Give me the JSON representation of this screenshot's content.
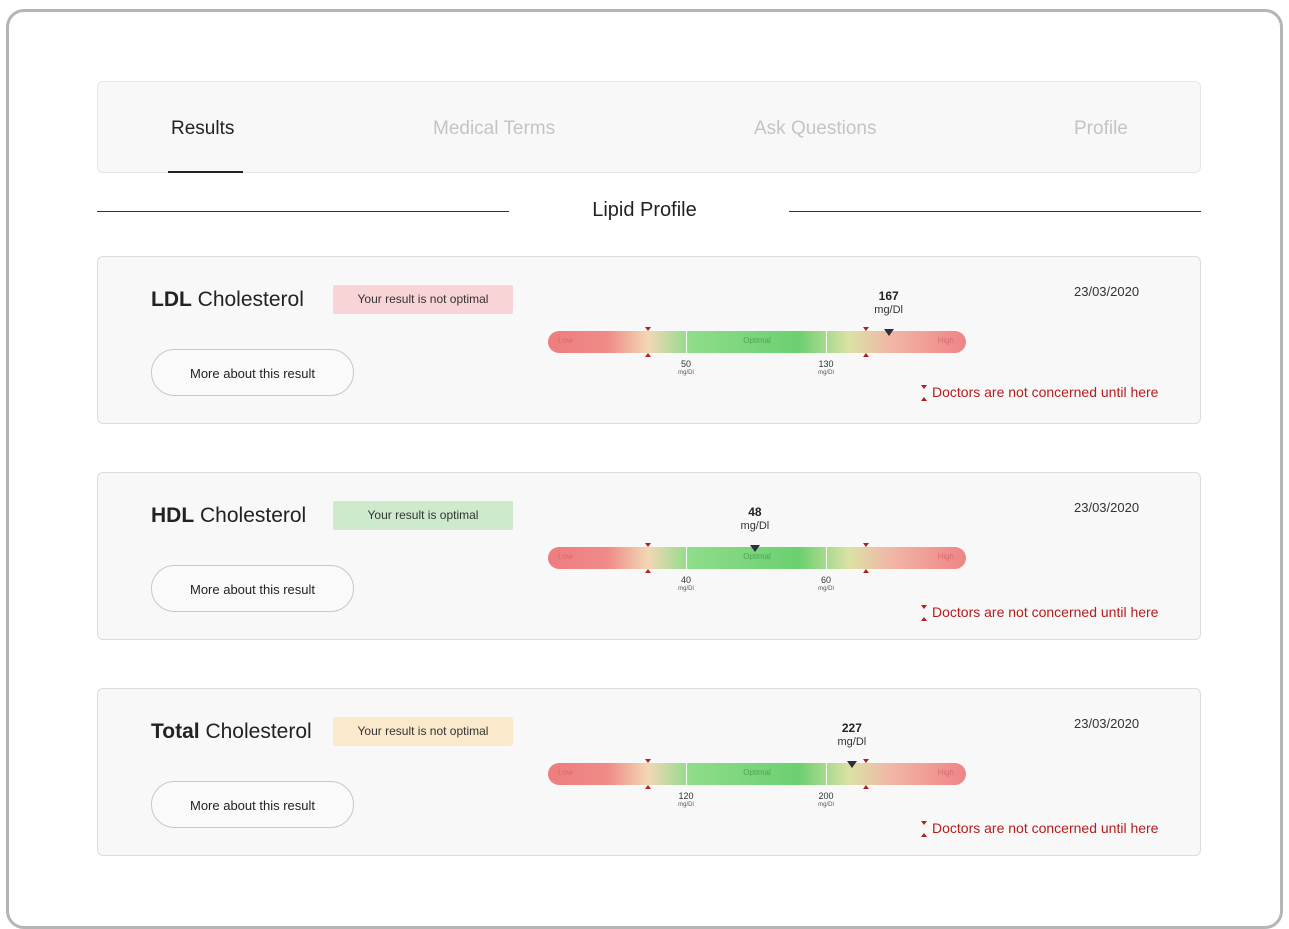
{
  "nav": {
    "tabs": [
      {
        "label": "Results"
      },
      {
        "label": "Medical Terms"
      },
      {
        "label": "Ask Questions"
      },
      {
        "label": "Profile"
      }
    ]
  },
  "section": {
    "title": "Lipid Profile"
  },
  "colors": {
    "badge_not_optimal_ldl": "#f9d4d6",
    "badge_optimal": "#cdeacd",
    "badge_not_optimal_total": "#fbe9cc",
    "alert": "#b51c1c"
  },
  "gauge_common": {
    "low": "Low",
    "optimal": "Optimal",
    "high": "High",
    "unit_small": "mg/Dl",
    "note": "Doctors are not concerned until here"
  },
  "results": [
    {
      "bold": "LDL",
      "name": " Cholesterol",
      "status": "Your result is not optimal",
      "status_color": "#f9d4d6",
      "button": "More about this result",
      "date": "23/03/2020",
      "value": "167",
      "unit": "mg/Dl",
      "tick_low": "50",
      "tick_high": "130",
      "value_fraction": 0.815
    },
    {
      "bold": "HDL",
      "name": " Cholesterol",
      "status": "Your result is optimal",
      "status_color": "#cdeacd",
      "button": "More about this result",
      "date": "23/03/2020",
      "value": "48",
      "unit": "mg/Dl",
      "tick_low": "40",
      "tick_high": "60",
      "value_fraction": 0.495
    },
    {
      "bold": "Total",
      "name": " Cholesterol",
      "status": "Your result is not optimal",
      "status_color": "#fbe9cc",
      "button": "More about this result",
      "date": "23/03/2020",
      "value": "227",
      "unit": "mg/Dl",
      "tick_low": "120",
      "tick_high": "200",
      "value_fraction": 0.727
    }
  ]
}
